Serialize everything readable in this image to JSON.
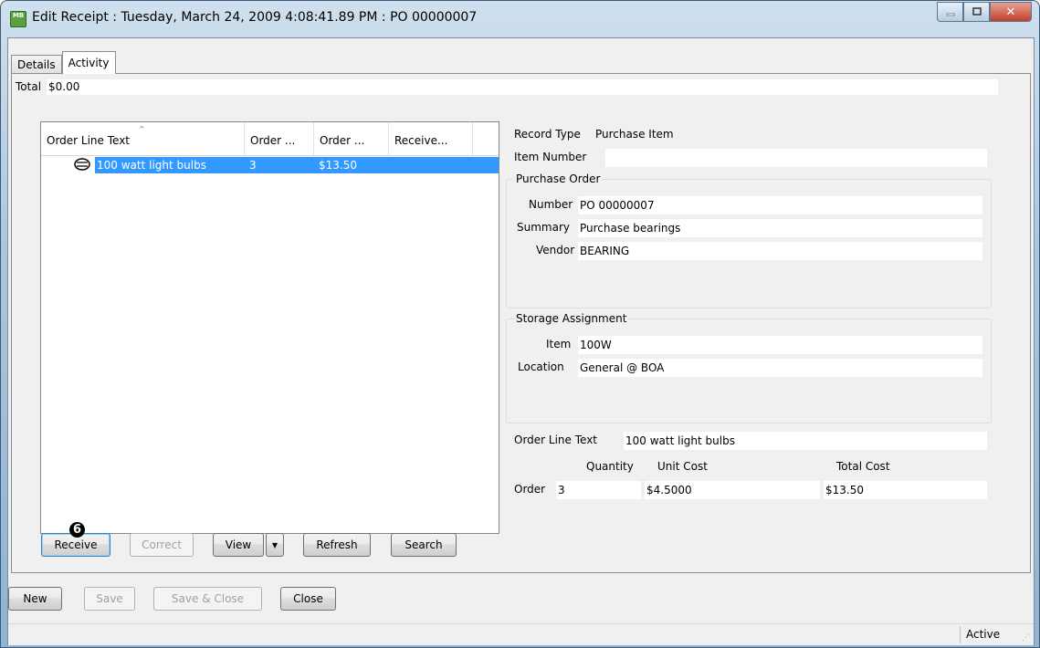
{
  "window": {
    "title": "Edit Receipt : Tuesday, March 24, 2009 4:08:41.89 PM : PO 00000007",
    "app_icon_text": "MB"
  },
  "tabs": [
    {
      "label": "Details",
      "active": false
    },
    {
      "label": "Activity",
      "active": true
    }
  ],
  "total": {
    "label": "Total",
    "value": "$0.00"
  },
  "list": {
    "columns": [
      "Order Line Text",
      "Order ...",
      "Order ...",
      "Receive..."
    ],
    "rows": [
      {
        "icon": "package-icon",
        "text": "100 watt light bulbs",
        "qty": "3",
        "cost": "$13.50",
        "received": ""
      }
    ]
  },
  "badge": "6",
  "list_buttons": {
    "receive": "Receive",
    "correct": "Correct",
    "view": "View",
    "view_dropdown": "▾",
    "refresh": "Refresh",
    "search": "Search"
  },
  "record": {
    "record_type_label": "Record Type",
    "record_type_value": "Purchase Item",
    "item_number_label": "Item Number",
    "item_number_value": ""
  },
  "purchase_order": {
    "title": "Purchase Order",
    "number_label": "Number",
    "number_value": "PO 00000007",
    "summary_label": "Summary",
    "summary_value": "Purchase bearings",
    "vendor_label": "Vendor",
    "vendor_value": "BEARING"
  },
  "storage": {
    "title": "Storage Assignment",
    "item_label": "Item",
    "item_value": "100W",
    "location_label": "Location",
    "location_value": "General @ BOA"
  },
  "order_line": {
    "label": "Order Line Text",
    "value": "100 watt light bulbs",
    "quantity_header": "Quantity",
    "unit_cost_header": "Unit Cost",
    "total_cost_header": "Total Cost",
    "row_label": "Order",
    "quantity": "3",
    "unit_cost": "$4.5000",
    "total_cost": "$13.50"
  },
  "bottom_buttons": {
    "new": "New",
    "save": "Save",
    "save_close": "Save & Close",
    "close": "Close"
  },
  "status": {
    "text": "Active"
  },
  "colors": {
    "selection": "#3399ff",
    "title_gradient_top": "#cfe0ee"
  }
}
